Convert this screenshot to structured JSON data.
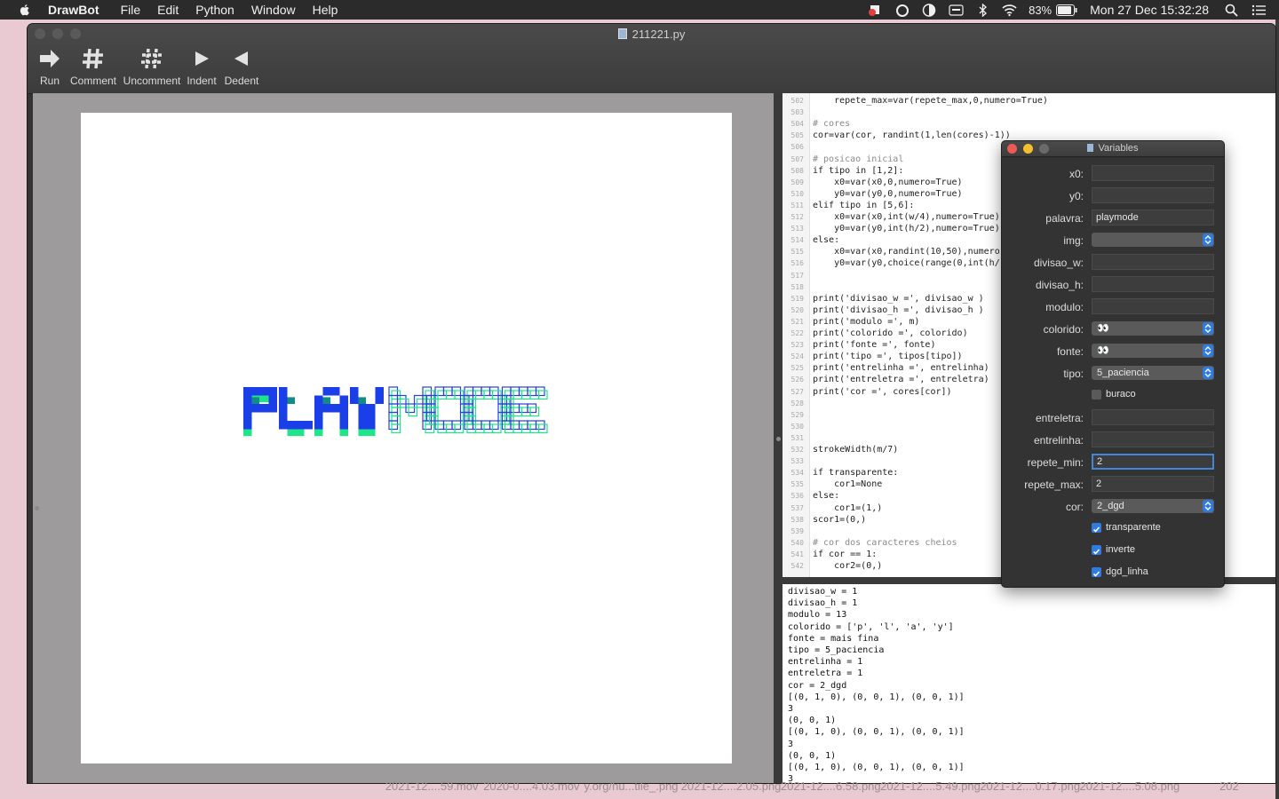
{
  "menubar": {
    "app_name": "DrawBot",
    "menus": [
      "File",
      "Edit",
      "Python",
      "Window",
      "Help"
    ],
    "battery": "83%",
    "clock": "Mon 27 Dec  15:32:28"
  },
  "window": {
    "title": "211221.py",
    "toolbar": [
      {
        "label": "Run",
        "icon": "run-arrow-icon"
      },
      {
        "label": "Comment",
        "icon": "hash-icon"
      },
      {
        "label": "Uncomment",
        "icon": "uncomment-hash-icon"
      },
      {
        "label": "Indent",
        "icon": "indent-triangle-icon"
      },
      {
        "label": "Dedent",
        "icon": "dedent-triangle-icon"
      }
    ]
  },
  "canvas": {
    "artwork_text": "PLAYMODE",
    "colors": {
      "fill_blue": "#1a3fe8",
      "fill_green": "#1fe58a",
      "teal": "#138c86",
      "outline_blue": "#2b3fd6"
    }
  },
  "code": {
    "lines": [
      {
        "n": "502",
        "t": "    repete_max=var(repete_max,0,numero=True)"
      },
      {
        "n": "503",
        "t": ""
      },
      {
        "n": "504",
        "t": "# cores",
        "c": true
      },
      {
        "n": "505",
        "t": "cor=var(cor, randint(1,len(cores)-1))"
      },
      {
        "n": "506",
        "t": ""
      },
      {
        "n": "507",
        "t": "# posicao inicial",
        "c": true
      },
      {
        "n": "508",
        "t": "if tipo in [1,2]:"
      },
      {
        "n": "509",
        "t": "    x0=var(x0,0,numero=True)"
      },
      {
        "n": "510",
        "t": "    y0=var(y0,0,numero=True)"
      },
      {
        "n": "511",
        "t": "elif tipo in [5,6]:"
      },
      {
        "n": "512",
        "t": "    x0=var(x0,int(w/4),numero=True)"
      },
      {
        "n": "513",
        "t": "    y0=var(y0,int(h/2),numero=True)"
      },
      {
        "n": "514",
        "t": "else:"
      },
      {
        "n": "515",
        "t": "    x0=var(x0,randint(10,50),numero"
      },
      {
        "n": "516",
        "t": "    y0=var(y0,choice(range(0,int(h/"
      },
      {
        "n": "517",
        "t": ""
      },
      {
        "n": "518",
        "t": ""
      },
      {
        "n": "519",
        "t": "print('divisao_w =', divisao_w )"
      },
      {
        "n": "520",
        "t": "print('divisao_h =', divisao_h )"
      },
      {
        "n": "521",
        "t": "print('modulo =', m)"
      },
      {
        "n": "522",
        "t": "print('colorido =', colorido)"
      },
      {
        "n": "523",
        "t": "print('fonte =', fonte)"
      },
      {
        "n": "524",
        "t": "print('tipo =', tipos[tipo])"
      },
      {
        "n": "525",
        "t": "print('entrelinha =', entrelinha)"
      },
      {
        "n": "526",
        "t": "print('entreletra =', entreletra)"
      },
      {
        "n": "527",
        "t": "print('cor =', cores[cor])"
      },
      {
        "n": "528",
        "t": ""
      },
      {
        "n": "529",
        "t": ""
      },
      {
        "n": "530",
        "t": ""
      },
      {
        "n": "531",
        "t": ""
      },
      {
        "n": "532",
        "t": "strokeWidth(m/7)"
      },
      {
        "n": "533",
        "t": ""
      },
      {
        "n": "534",
        "t": "if transparente:"
      },
      {
        "n": "535",
        "t": "    cor1=None"
      },
      {
        "n": "536",
        "t": "else:"
      },
      {
        "n": "537",
        "t": "    cor1=(1,)"
      },
      {
        "n": "538",
        "t": "scor1=(0,)"
      },
      {
        "n": "539",
        "t": ""
      },
      {
        "n": "540",
        "t": "# cor dos caracteres cheios",
        "c": true
      },
      {
        "n": "541",
        "t": "if cor == 1:"
      },
      {
        "n": "542",
        "t": "    cor2=(0,)"
      }
    ]
  },
  "output": {
    "lines": [
      "divisao_w = 1",
      "divisao_h = 1",
      "modulo = 13",
      "colorido = ['p', 'l', 'a', 'y']",
      "fonte = mais fina",
      "tipo = 5_paciencia",
      "entrelinha = 1",
      "entreletra = 1",
      "cor = 2_dgd",
      "[(0, 1, 0), (0, 0, 1), (0, 0, 1)]",
      "3",
      "(0, 0, 1)",
      "[(0, 1, 0), (0, 0, 1), (0, 0, 1)]",
      "3",
      "(0, 0, 1)",
      "[(0, 1, 0), (0, 0, 1), (0, 0, 1)]",
      "3"
    ]
  },
  "variables_panel": {
    "title": "Variables",
    "rows": [
      {
        "label": "x0:",
        "kind": "text",
        "value": ""
      },
      {
        "label": "y0:",
        "kind": "text",
        "value": ""
      },
      {
        "label": "palavra:",
        "kind": "text",
        "value": "playmode"
      },
      {
        "label": "img:",
        "kind": "select",
        "value": ""
      },
      {
        "label": "divisao_w:",
        "kind": "text",
        "value": ""
      },
      {
        "label": "divisao_h:",
        "kind": "text",
        "value": ""
      },
      {
        "label": "modulo:",
        "kind": "text",
        "value": ""
      },
      {
        "label": "colorido:",
        "kind": "select",
        "value": "👀"
      },
      {
        "label": "fonte:",
        "kind": "select",
        "value": "👀"
      },
      {
        "label": "tipo:",
        "kind": "select",
        "value": "5_paciencia"
      },
      {
        "label": "",
        "kind": "check",
        "value": "buraco",
        "checked": false
      },
      {
        "label": "entreletra:",
        "kind": "text",
        "value": ""
      },
      {
        "label": "entrelinha:",
        "kind": "text",
        "value": ""
      },
      {
        "label": "repete_min:",
        "kind": "text",
        "value": "2",
        "focused": true
      },
      {
        "label": "repete_max:",
        "kind": "text",
        "value": "2"
      },
      {
        "label": "cor:",
        "kind": "select",
        "value": "2_dgd"
      },
      {
        "label": "",
        "kind": "check",
        "value": "transparente",
        "checked": true
      },
      {
        "label": "",
        "kind": "check",
        "value": "inverte",
        "checked": true
      },
      {
        "label": "",
        "kind": "check",
        "value": "dgd_linha",
        "checked": true
      }
    ]
  },
  "desktop": {
    "dock_files": [
      "2021-12....59.mov",
      "2020-0....4.03.mov",
      "y.org/hu...tile_.png",
      "2021-12....2.05.png",
      "2021-12....6.58.png",
      "2021-12....5.49.png",
      "2021-12....0.17.png",
      "2021-12....5.08.png",
      "202"
    ]
  }
}
